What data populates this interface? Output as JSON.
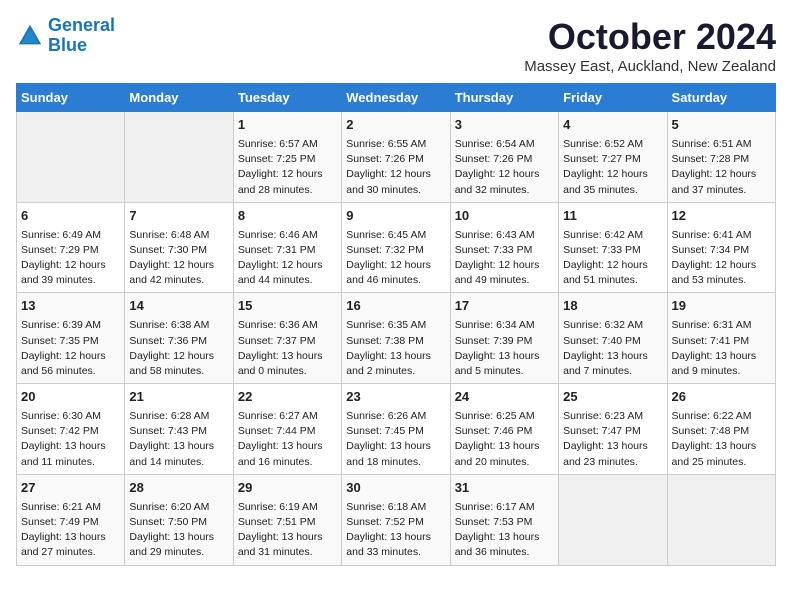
{
  "logo": {
    "line1": "General",
    "line2": "Blue"
  },
  "title": "October 2024",
  "location": "Massey East, Auckland, New Zealand",
  "days_of_week": [
    "Sunday",
    "Monday",
    "Tuesday",
    "Wednesday",
    "Thursday",
    "Friday",
    "Saturday"
  ],
  "weeks": [
    [
      {
        "day": "",
        "empty": true
      },
      {
        "day": "",
        "empty": true
      },
      {
        "day": "1",
        "sunrise": "Sunrise: 6:57 AM",
        "sunset": "Sunset: 7:25 PM",
        "daylight": "Daylight: 12 hours and 28 minutes."
      },
      {
        "day": "2",
        "sunrise": "Sunrise: 6:55 AM",
        "sunset": "Sunset: 7:26 PM",
        "daylight": "Daylight: 12 hours and 30 minutes."
      },
      {
        "day": "3",
        "sunrise": "Sunrise: 6:54 AM",
        "sunset": "Sunset: 7:26 PM",
        "daylight": "Daylight: 12 hours and 32 minutes."
      },
      {
        "day": "4",
        "sunrise": "Sunrise: 6:52 AM",
        "sunset": "Sunset: 7:27 PM",
        "daylight": "Daylight: 12 hours and 35 minutes."
      },
      {
        "day": "5",
        "sunrise": "Sunrise: 6:51 AM",
        "sunset": "Sunset: 7:28 PM",
        "daylight": "Daylight: 12 hours and 37 minutes."
      }
    ],
    [
      {
        "day": "6",
        "sunrise": "Sunrise: 6:49 AM",
        "sunset": "Sunset: 7:29 PM",
        "daylight": "Daylight: 12 hours and 39 minutes."
      },
      {
        "day": "7",
        "sunrise": "Sunrise: 6:48 AM",
        "sunset": "Sunset: 7:30 PM",
        "daylight": "Daylight: 12 hours and 42 minutes."
      },
      {
        "day": "8",
        "sunrise": "Sunrise: 6:46 AM",
        "sunset": "Sunset: 7:31 PM",
        "daylight": "Daylight: 12 hours and 44 minutes."
      },
      {
        "day": "9",
        "sunrise": "Sunrise: 6:45 AM",
        "sunset": "Sunset: 7:32 PM",
        "daylight": "Daylight: 12 hours and 46 minutes."
      },
      {
        "day": "10",
        "sunrise": "Sunrise: 6:43 AM",
        "sunset": "Sunset: 7:33 PM",
        "daylight": "Daylight: 12 hours and 49 minutes."
      },
      {
        "day": "11",
        "sunrise": "Sunrise: 6:42 AM",
        "sunset": "Sunset: 7:33 PM",
        "daylight": "Daylight: 12 hours and 51 minutes."
      },
      {
        "day": "12",
        "sunrise": "Sunrise: 6:41 AM",
        "sunset": "Sunset: 7:34 PM",
        "daylight": "Daylight: 12 hours and 53 minutes."
      }
    ],
    [
      {
        "day": "13",
        "sunrise": "Sunrise: 6:39 AM",
        "sunset": "Sunset: 7:35 PM",
        "daylight": "Daylight: 12 hours and 56 minutes."
      },
      {
        "day": "14",
        "sunrise": "Sunrise: 6:38 AM",
        "sunset": "Sunset: 7:36 PM",
        "daylight": "Daylight: 12 hours and 58 minutes."
      },
      {
        "day": "15",
        "sunrise": "Sunrise: 6:36 AM",
        "sunset": "Sunset: 7:37 PM",
        "daylight": "Daylight: 13 hours and 0 minutes."
      },
      {
        "day": "16",
        "sunrise": "Sunrise: 6:35 AM",
        "sunset": "Sunset: 7:38 PM",
        "daylight": "Daylight: 13 hours and 2 minutes."
      },
      {
        "day": "17",
        "sunrise": "Sunrise: 6:34 AM",
        "sunset": "Sunset: 7:39 PM",
        "daylight": "Daylight: 13 hours and 5 minutes."
      },
      {
        "day": "18",
        "sunrise": "Sunrise: 6:32 AM",
        "sunset": "Sunset: 7:40 PM",
        "daylight": "Daylight: 13 hours and 7 minutes."
      },
      {
        "day": "19",
        "sunrise": "Sunrise: 6:31 AM",
        "sunset": "Sunset: 7:41 PM",
        "daylight": "Daylight: 13 hours and 9 minutes."
      }
    ],
    [
      {
        "day": "20",
        "sunrise": "Sunrise: 6:30 AM",
        "sunset": "Sunset: 7:42 PM",
        "daylight": "Daylight: 13 hours and 11 minutes."
      },
      {
        "day": "21",
        "sunrise": "Sunrise: 6:28 AM",
        "sunset": "Sunset: 7:43 PM",
        "daylight": "Daylight: 13 hours and 14 minutes."
      },
      {
        "day": "22",
        "sunrise": "Sunrise: 6:27 AM",
        "sunset": "Sunset: 7:44 PM",
        "daylight": "Daylight: 13 hours and 16 minutes."
      },
      {
        "day": "23",
        "sunrise": "Sunrise: 6:26 AM",
        "sunset": "Sunset: 7:45 PM",
        "daylight": "Daylight: 13 hours and 18 minutes."
      },
      {
        "day": "24",
        "sunrise": "Sunrise: 6:25 AM",
        "sunset": "Sunset: 7:46 PM",
        "daylight": "Daylight: 13 hours and 20 minutes."
      },
      {
        "day": "25",
        "sunrise": "Sunrise: 6:23 AM",
        "sunset": "Sunset: 7:47 PM",
        "daylight": "Daylight: 13 hours and 23 minutes."
      },
      {
        "day": "26",
        "sunrise": "Sunrise: 6:22 AM",
        "sunset": "Sunset: 7:48 PM",
        "daylight": "Daylight: 13 hours and 25 minutes."
      }
    ],
    [
      {
        "day": "27",
        "sunrise": "Sunrise: 6:21 AM",
        "sunset": "Sunset: 7:49 PM",
        "daylight": "Daylight: 13 hours and 27 minutes."
      },
      {
        "day": "28",
        "sunrise": "Sunrise: 6:20 AM",
        "sunset": "Sunset: 7:50 PM",
        "daylight": "Daylight: 13 hours and 29 minutes."
      },
      {
        "day": "29",
        "sunrise": "Sunrise: 6:19 AM",
        "sunset": "Sunset: 7:51 PM",
        "daylight": "Daylight: 13 hours and 31 minutes."
      },
      {
        "day": "30",
        "sunrise": "Sunrise: 6:18 AM",
        "sunset": "Sunset: 7:52 PM",
        "daylight": "Daylight: 13 hours and 33 minutes."
      },
      {
        "day": "31",
        "sunrise": "Sunrise: 6:17 AM",
        "sunset": "Sunset: 7:53 PM",
        "daylight": "Daylight: 13 hours and 36 minutes."
      },
      {
        "day": "",
        "empty": true
      },
      {
        "day": "",
        "empty": true
      }
    ]
  ]
}
